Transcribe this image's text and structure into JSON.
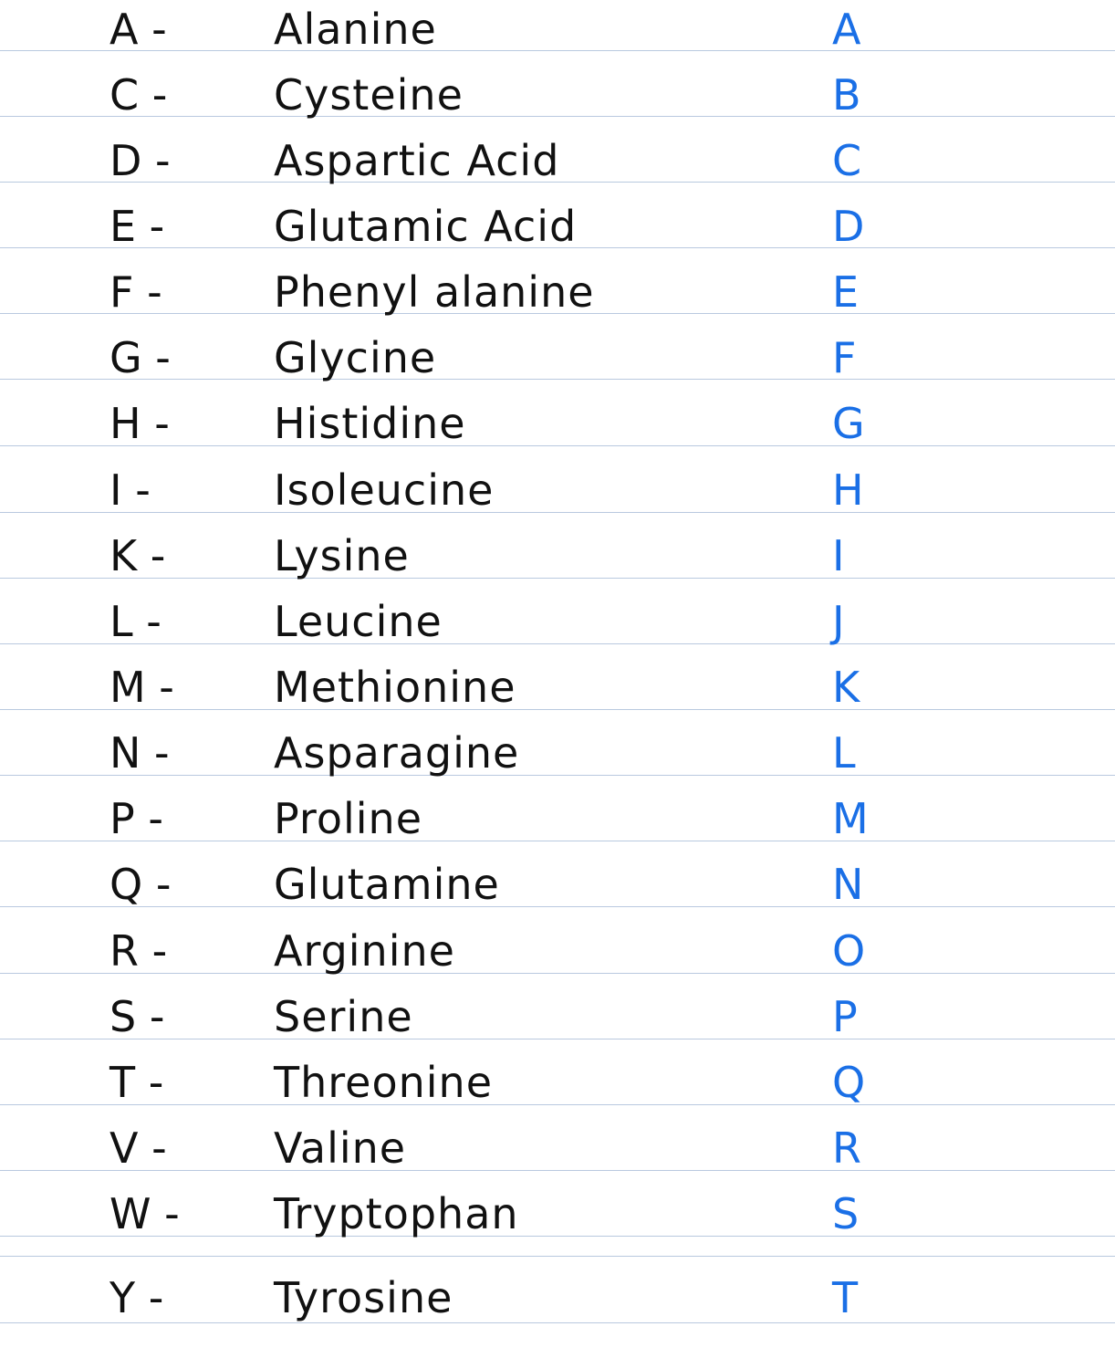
{
  "entries": [
    {
      "code": "A -",
      "name": "Alanine"
    },
    {
      "code": "C -",
      "name": "Cysteine"
    },
    {
      "code": "D -",
      "name": "Aspartic Acid"
    },
    {
      "code": "E -",
      "name": "Glutamic Acid"
    },
    {
      "code": "F -",
      "name": "Phenyl alanine"
    },
    {
      "code": "G -",
      "name": "Glycine"
    },
    {
      "code": "H -",
      "name": "Histidine"
    },
    {
      "code": "I -",
      "name": "Isoleucine"
    },
    {
      "code": "K -",
      "name": "Lysine"
    },
    {
      "code": "L -",
      "name": "Leucine"
    },
    {
      "code": "M -",
      "name": "Methionine"
    },
    {
      "code": "N -",
      "name": "Asparagine"
    },
    {
      "code": "P -",
      "name": "Proline"
    },
    {
      "code": "Q -",
      "name": "Glutamine"
    },
    {
      "code": "R -",
      "name": "Arginine"
    },
    {
      "code": "S -",
      "name": "Serine"
    },
    {
      "code": "T -",
      "name": "Threonine"
    },
    {
      "code": "V -",
      "name": "Valine"
    },
    {
      "code": "W -",
      "name": "Tryptophan"
    },
    {
      "code": "Y -",
      "name": "Tyrosine"
    }
  ],
  "alphabet": [
    "A",
    "B",
    "C",
    "D",
    "E",
    "F",
    "G",
    "H",
    "I",
    "J",
    "K",
    "L",
    "M",
    "N",
    "O",
    "P",
    "Q",
    "R",
    "S",
    "T"
  ],
  "colors": {
    "ink": "#111111",
    "blue_ink": "#1a6fe6",
    "rule_line": "#b9c9df"
  }
}
